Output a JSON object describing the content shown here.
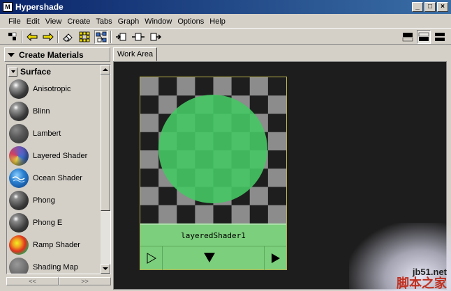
{
  "window": {
    "title": "Hypershade",
    "app_icon": "M",
    "controls": [
      "_",
      "□",
      "×"
    ]
  },
  "menu": [
    "File",
    "Edit",
    "View",
    "Create",
    "Tabs",
    "Graph",
    "Window",
    "Options",
    "Help"
  ],
  "toolbar": {
    "left_icons": [
      "toggle-panel-icon",
      "arrow-left-icon",
      "arrow-right-icon",
      "eraser-icon",
      "grid-arrange-icon",
      "graph-network-icon",
      "input-connections-icon",
      "input-output-connections-icon",
      "output-connections-icon"
    ],
    "right_icons": [
      "layout-top-icon",
      "layout-bottom-icon",
      "layout-split-icon"
    ]
  },
  "create_panel": {
    "header": "Create Materials",
    "section": "Surface",
    "items": [
      {
        "label": "Anisotropic",
        "color": "#4a4a4a"
      },
      {
        "label": "Blinn",
        "color": "#4a4a4a"
      },
      {
        "label": "Lambert",
        "color": "#4a4a4a"
      },
      {
        "label": "Layered Shader",
        "color": "#8a6ab0"
      },
      {
        "label": "Ocean Shader",
        "color": "#2a6fb0"
      },
      {
        "label": "Phong",
        "color": "#4a4a4a"
      },
      {
        "label": "Phong E",
        "color": "#4a4a4a"
      },
      {
        "label": "Ramp Shader",
        "color": "#d04020"
      },
      {
        "label": "Shading Map",
        "color": "#6a6a6a"
      }
    ],
    "scroll_left": "<<",
    "scroll_right": ">>"
  },
  "work_area": {
    "tab": "Work Area",
    "node": {
      "name": "layeredShader1",
      "checker_dark": "#1e1e1e",
      "checker_light": "#8c8c8c",
      "sphere_color": "#45c763",
      "node_color": "#7ccf7c"
    }
  },
  "watermark": {
    "site": "jb51.net",
    "brand": "脚本之家"
  }
}
